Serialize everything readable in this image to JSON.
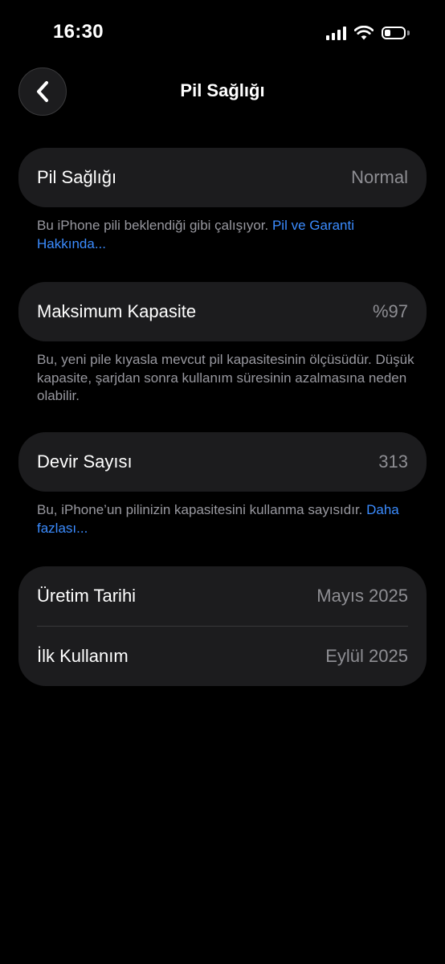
{
  "status_bar": {
    "time": "16:30",
    "icons": [
      "cellular-signal-icon",
      "wifi-icon",
      "battery-icon"
    ],
    "battery_level": 0.3
  },
  "nav": {
    "back_icon": "chevron-left-icon",
    "title": "Pil Sağlığı"
  },
  "battery_health": {
    "label": "Pil Sağlığı",
    "value": "Normal",
    "note": "Bu iPhone pili beklendiği gibi çalışıyor.",
    "link": "Pil ve Garanti Hakkında..."
  },
  "max_capacity": {
    "label": "Maksimum Kapasite",
    "value": "%97",
    "note": "Bu, yeni pile kıyasla mevcut pil kapasitesinin ölçüsüdür. Düşük kapasite, şarjdan sonra kullanım süresinin azalmasına neden olabilir."
  },
  "cycle_count": {
    "label": "Devir Sayısı",
    "value": "313",
    "note": "Bu, iPhone’un pilinizin kapasitesini kullanma sayısıdır.",
    "link": "Daha fazlası..."
  },
  "dates": {
    "manufacture_label": "Üretim Tarihi",
    "manufacture_value": "Mayıs 2025",
    "first_use_label": "İlk Kullanım",
    "first_use_value": "Eylül 2025"
  },
  "colors": {
    "background": "#000000",
    "card": "#1c1c1e",
    "secondary_text": "#8e8e93",
    "link": "#3b8cff"
  }
}
